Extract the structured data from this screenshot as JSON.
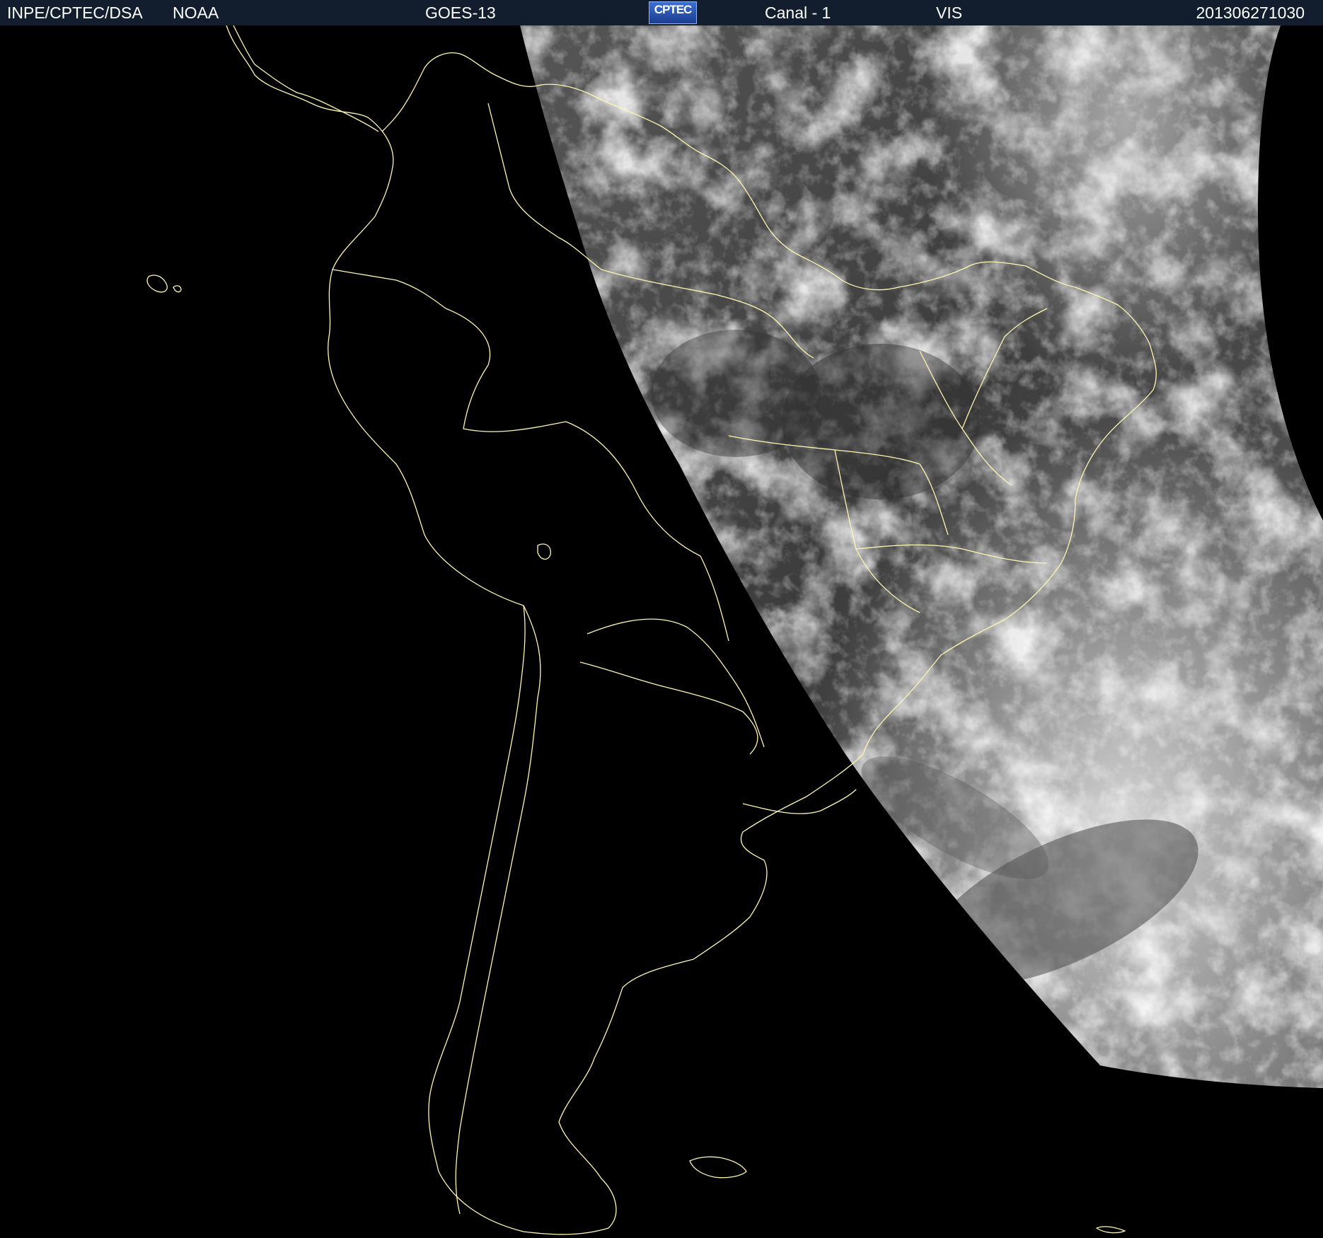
{
  "header": {
    "organization": "INPE/CPTEC/DSA",
    "agency": "NOAA",
    "satellite": "GOES-13",
    "logo_text": "CPTEC",
    "channel": "Canal - 1",
    "band": "VIS",
    "timestamp": "201306271030"
  },
  "colors": {
    "header_background": "#121e2e",
    "header_text": "#ffffff",
    "ocean_night": "#000000",
    "borders": "#fff6b0",
    "cloud_bright": "#f2f2f2",
    "surface_dark": "#3a3a3a"
  },
  "map": {
    "type": "satellite-visible-image",
    "region": "South America",
    "boundaries_overlay": true,
    "day_night_terminator": true
  }
}
